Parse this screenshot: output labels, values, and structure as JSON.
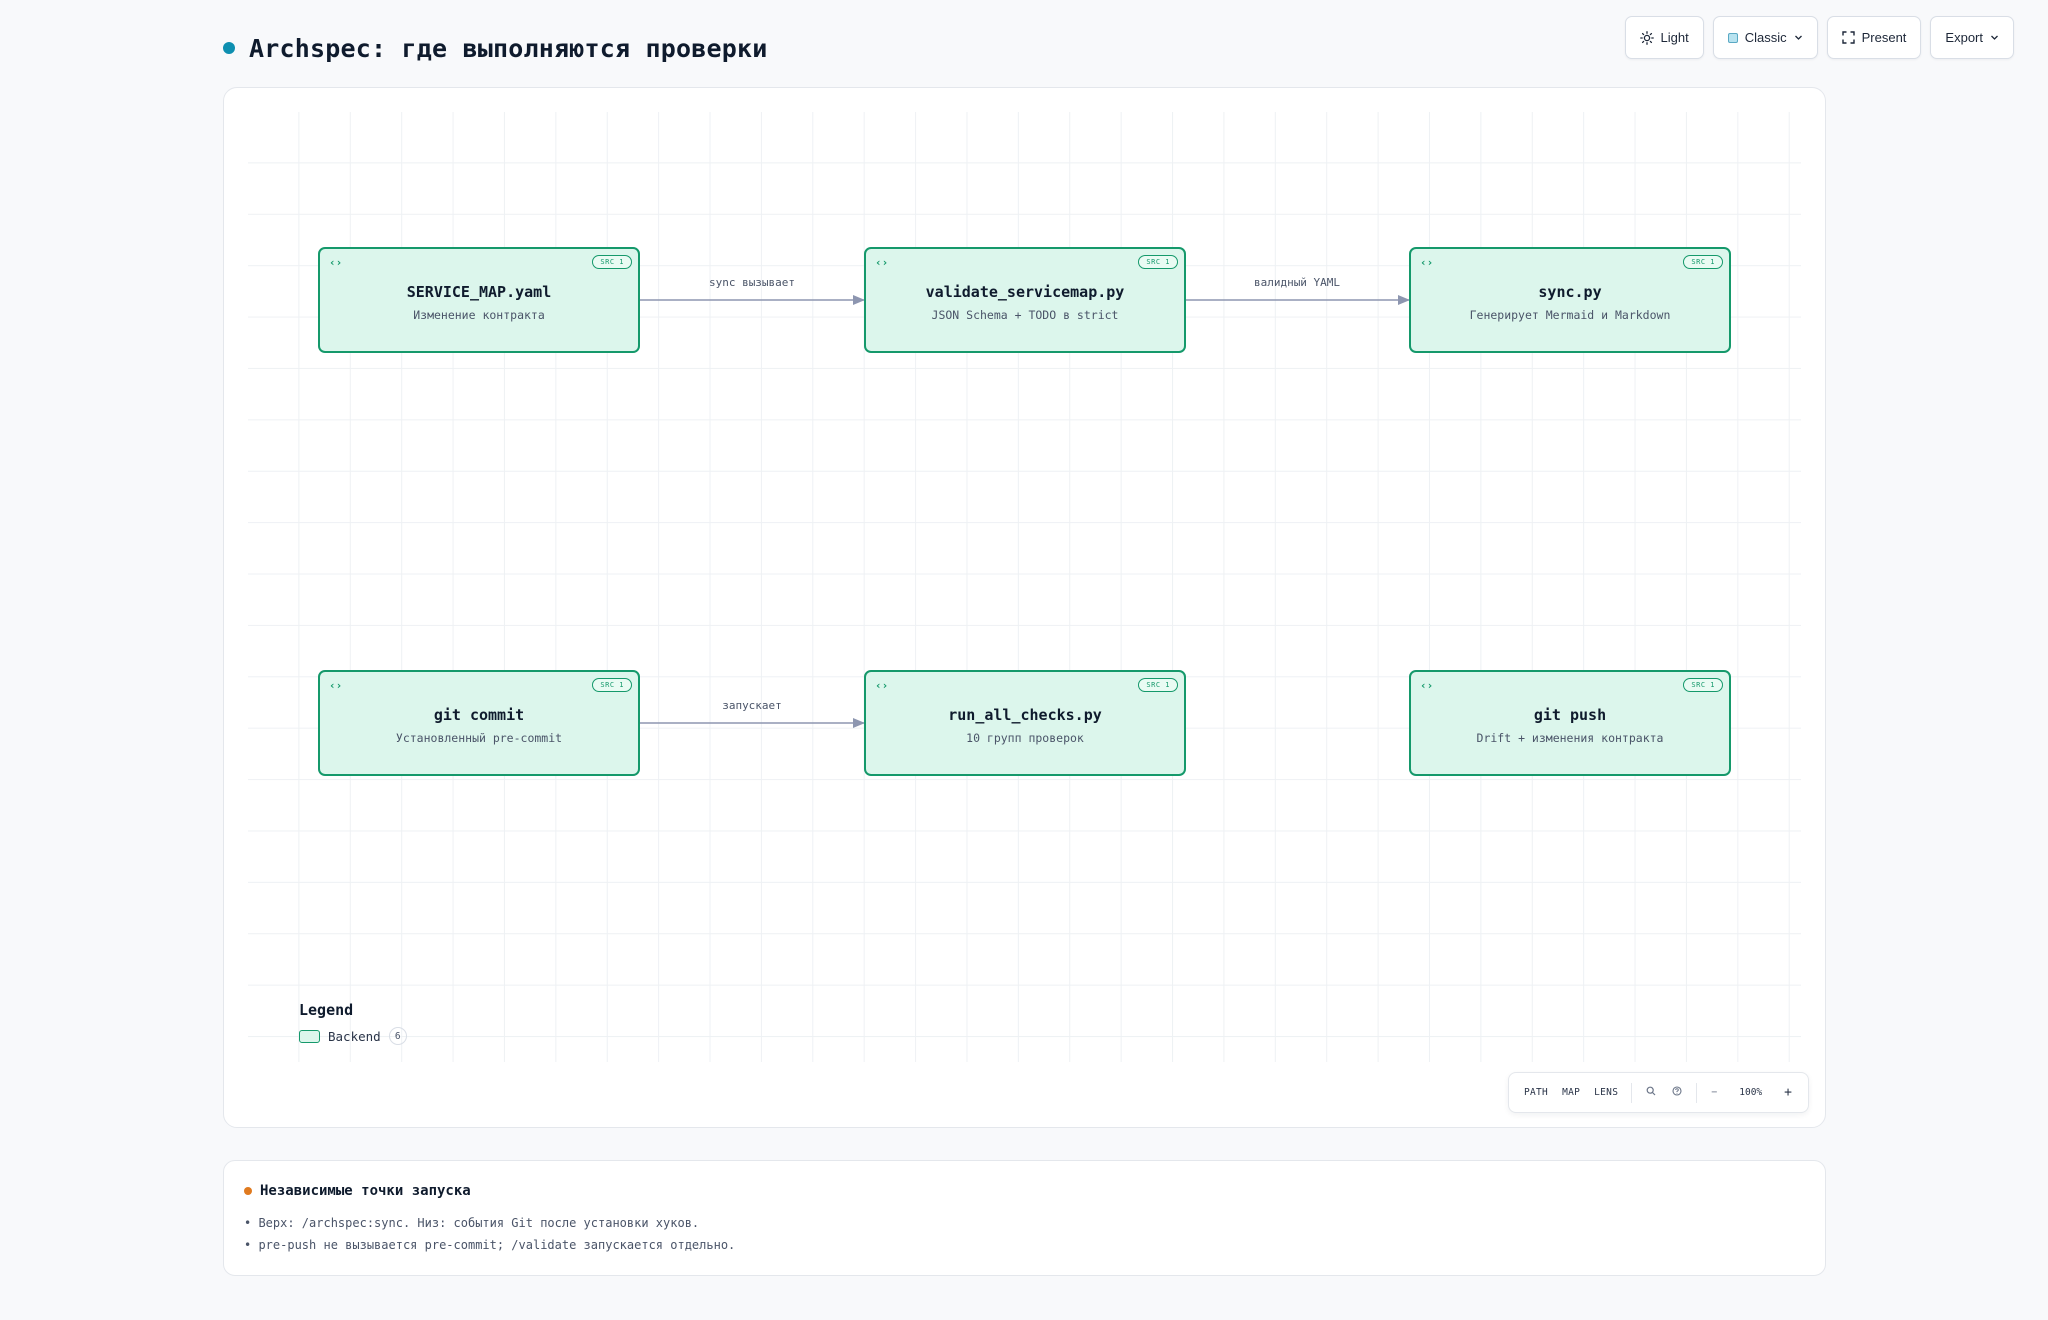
{
  "header": {
    "title": "Archspec: где выполняются проверки",
    "accent_color": "#0e8fb0"
  },
  "toolbar": {
    "theme": {
      "label": "Light",
      "icon": "sun-icon"
    },
    "style": {
      "label": "Classic",
      "icon": "swatch-icon"
    },
    "present": {
      "label": "Present",
      "icon": "fullscreen-icon"
    },
    "export": {
      "label": "Export",
      "icon": "chevron-down-icon"
    }
  },
  "diagram": {
    "node_fill": "#dcf6ec",
    "node_border": "#15996b",
    "nodes": [
      {
        "id": "service_map",
        "title": "SERVICE_MAP.yaml",
        "subtitle": "Изменение контракта",
        "badge": "SRC 1",
        "icon": "code-icon"
      },
      {
        "id": "validate",
        "title": "validate_servicemap.py",
        "subtitle": "JSON Schema + TODO в strict",
        "badge": "SRC 1",
        "icon": "code-icon"
      },
      {
        "id": "sync",
        "title": "sync.py",
        "subtitle": "Генерирует Mermaid и Markdown",
        "badge": "SRC 1",
        "icon": "code-icon"
      },
      {
        "id": "git_commit",
        "title": "git commit",
        "subtitle": "Установленный pre-commit",
        "badge": "SRC 1",
        "icon": "code-icon"
      },
      {
        "id": "run_all_checks",
        "title": "run_all_checks.py",
        "subtitle": "10 групп проверок",
        "badge": "SRC 1",
        "icon": "code-icon"
      },
      {
        "id": "git_push",
        "title": "git push",
        "subtitle": "Drift + изменения контракта",
        "badge": "SRC 1",
        "icon": "code-icon"
      }
    ],
    "edges": [
      {
        "from": "service_map",
        "to": "validate",
        "label": "sync вызывает"
      },
      {
        "from": "validate",
        "to": "sync",
        "label": "валидный YAML"
      },
      {
        "from": "git_commit",
        "to": "run_all_checks",
        "label": "запускает"
      }
    ],
    "legend": {
      "title": "Legend",
      "items": [
        {
          "label": "Backend",
          "count": "6"
        }
      ]
    }
  },
  "canvas_controls": {
    "path": "PATH",
    "map": "MAP",
    "lens": "LENS",
    "zoom_out": "−",
    "zoom": "100%",
    "zoom_in": "+"
  },
  "notes": {
    "title": "Независимые точки запуска",
    "dot_color": "#e07a1f",
    "lines": [
      "• Верх: /archspec:sync. Низ: события Git после установки хуков.",
      "• pre-push не вызывается pre-commit; /validate запускается отдельно."
    ]
  }
}
